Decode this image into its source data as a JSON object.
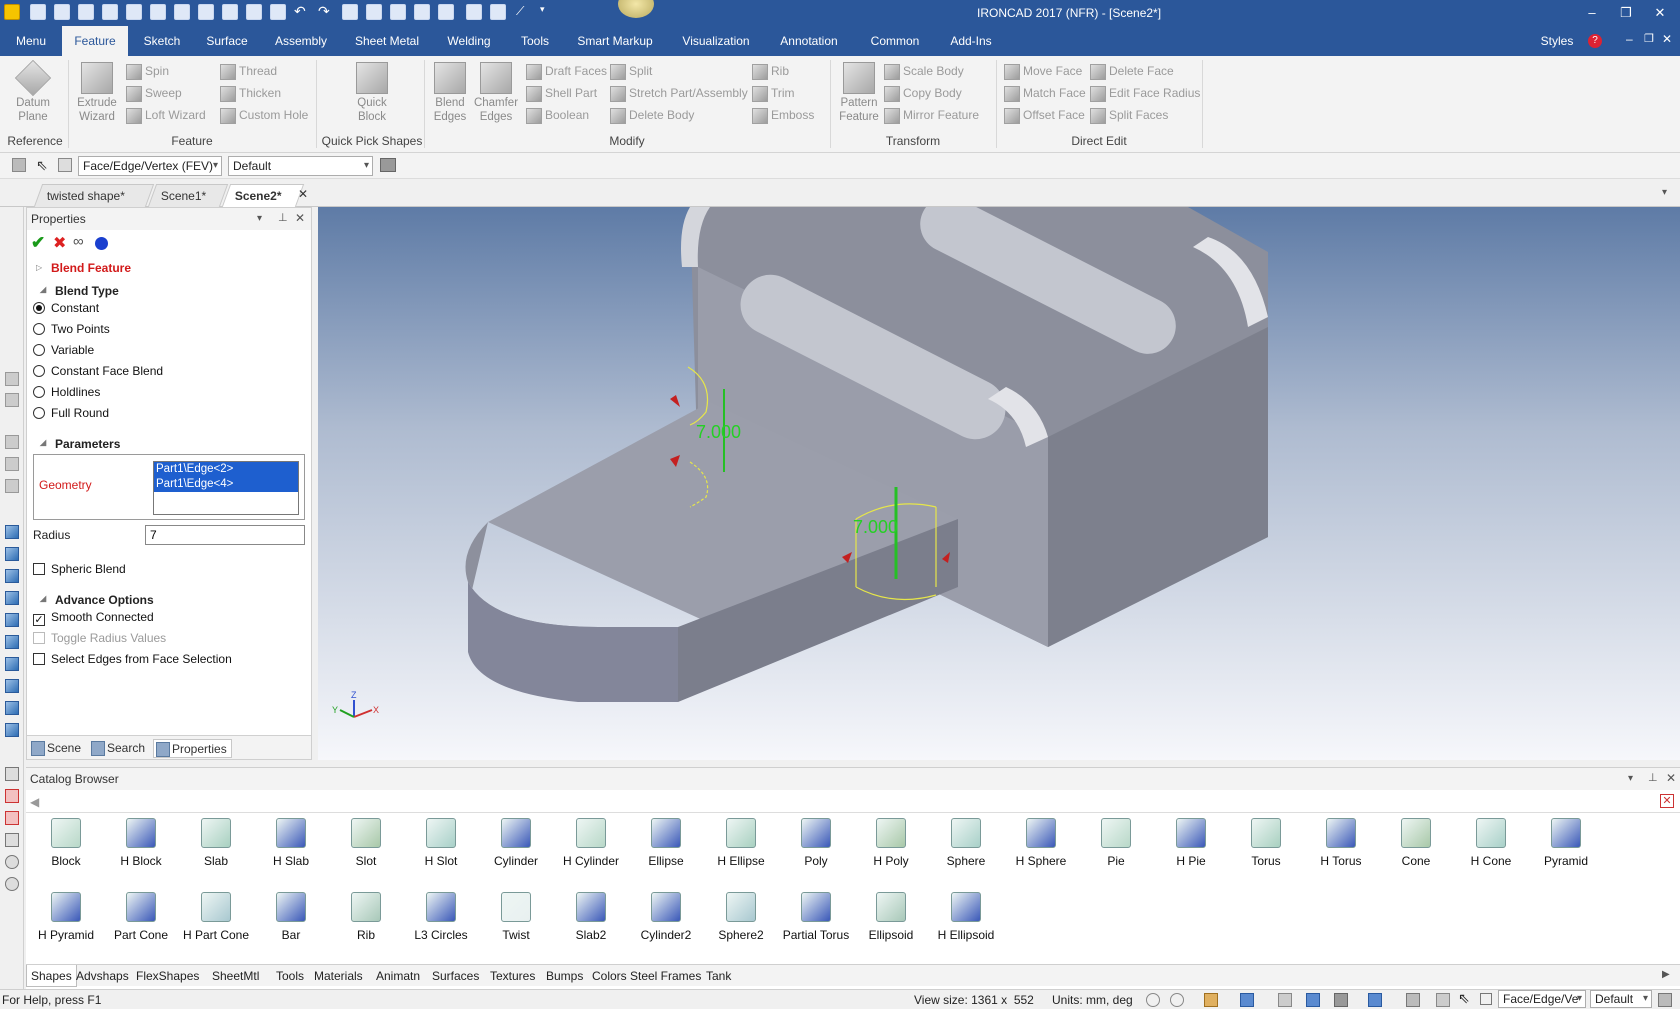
{
  "app": {
    "title": "IRONCAD 2017 (NFR) - [Scene2*]"
  },
  "ribbon_tabs": [
    "Menu",
    "Feature",
    "Sketch",
    "Surface",
    "Assembly",
    "Sheet Metal",
    "Welding",
    "Tools",
    "Smart Markup",
    "Visualization",
    "Annotation",
    "Common",
    "Add-Ins"
  ],
  "styles_label": "Styles",
  "ribbon": {
    "reference": {
      "datum_plane": "Datum Plane",
      "label": "Reference"
    },
    "feature": {
      "extrude_wizard": "Extrude Wizard",
      "spin": "Spin",
      "sweep": "Sweep",
      "loft_wizard": "Loft Wizard",
      "thread": "Thread",
      "thicken": "Thicken",
      "custom_hole": "Custom Hole",
      "label": "Feature"
    },
    "quick_pick": {
      "quick_block": "Quick Block",
      "label": "Quick Pick Shapes"
    },
    "modify": {
      "blend_edges": "Blend Edges",
      "chamfer_edges": "Chamfer Edges",
      "draft_faces": "Draft Faces",
      "shell_part": "Shell Part",
      "boolean": "Boolean",
      "split": "Split",
      "stretch": "Stretch Part/Assembly",
      "delete_body": "Delete Body",
      "rib": "Rib",
      "trim": "Trim",
      "emboss": "Emboss",
      "label": "Modify"
    },
    "transform": {
      "pattern_feature": "Pattern Feature",
      "scale_body": "Scale Body",
      "copy_body": "Copy Body",
      "mirror_feature": "Mirror Feature",
      "label": "Transform"
    },
    "direct_edit": {
      "move_face": "Move Face",
      "match_face": "Match Face",
      "offset_face": "Offset Face",
      "delete_face": "Delete Face",
      "edit_face_radius": "Edit Face Radius",
      "split_faces": "Split Faces",
      "label": "Direct Edit"
    }
  },
  "selection_bar": {
    "filter": "Face/Edge/Vertex (FEV)",
    "style": "Default"
  },
  "doc_tabs": [
    "twisted shape*",
    "Scene1*",
    "Scene2*"
  ],
  "properties": {
    "title": "Properties",
    "feature": "Blend Feature",
    "blend_type": "Blend Type",
    "options": [
      "Constant",
      "Two Points",
      "Variable",
      "Constant Face Blend",
      "Holdlines",
      "Full Round"
    ],
    "parameters": "Parameters",
    "geometry_label": "Geometry",
    "geometry_items": [
      "Part1\\Edge<2>",
      "Part1\\Edge<4>"
    ],
    "radius_label": "Radius",
    "radius_value": "7",
    "spheric_blend": "Spheric Blend",
    "advance_options": "Advance Options",
    "smooth_connected": "Smooth Connected",
    "toggle_radius": "Toggle Radius Values",
    "select_edges": "Select Edges from Face Selection",
    "tabs": [
      "Scene",
      "Search",
      "Properties"
    ]
  },
  "viewport": {
    "dim1": "7.000",
    "dim2": "7.000",
    "axis_x": "X",
    "axis_y": "Y",
    "axis_z": "Z"
  },
  "catalog": {
    "title": "Catalog Browser",
    "row1": [
      "Block",
      "H Block",
      "Slab",
      "H Slab",
      "Slot",
      "H Slot",
      "Cylinder",
      "H Cylinder",
      "Ellipse",
      "H Ellipse",
      "Poly",
      "H Poly",
      "Sphere",
      "H Sphere",
      "Pie",
      "H Pie",
      "Torus",
      "H Torus",
      "Cone",
      "H Cone",
      "Pyramid"
    ],
    "row2": [
      "H Pyramid",
      "Part Cone",
      "H Part Cone",
      "Bar",
      "Rib",
      "L3 Circles",
      "Twist",
      "Slab2",
      "Cylinder2",
      "Sphere2",
      "Partial Torus",
      "Ellipsoid",
      "H Ellipsoid"
    ],
    "bottom_tabs": [
      "Shapes",
      "Advshaps",
      "FlexShapes",
      "SheetMtl",
      "Tools",
      "Materials",
      "Animatn",
      "Surfaces",
      "Textures",
      "Bumps",
      "Colors",
      "Steel Frames",
      "Tank"
    ]
  },
  "status": {
    "help": "For Help, press F1",
    "view_size": "View size: 1361 x  552",
    "units": "Units: mm, deg",
    "filter": "Face/Edge/Ve",
    "style": "Default"
  }
}
